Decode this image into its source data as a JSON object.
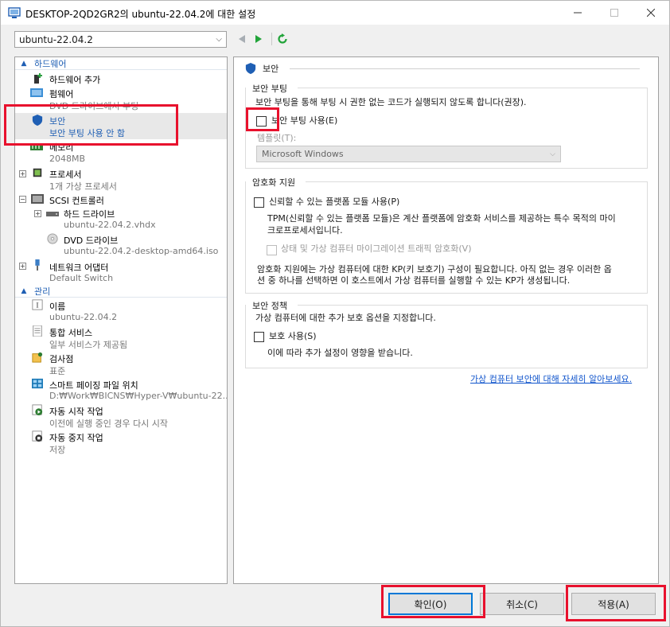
{
  "window": {
    "title": "DESKTOP-2QD2GR2의 ubuntu-22.04.2에 대한 설정"
  },
  "vm_selector": {
    "value": "ubuntu-22.04.2"
  },
  "tree": {
    "hardware_header": "하드웨어",
    "management_header": "관리",
    "hardware_items": [
      {
        "name": "하드웨어 추가",
        "sub": ""
      },
      {
        "name": "펌웨어",
        "sub": "DVD 드라이브에서 부팅"
      },
      {
        "name": "보안",
        "sub": "보안 부팅 사용 안 함"
      },
      {
        "name": "메모리",
        "sub": "2048MB"
      },
      {
        "name": "프로세서",
        "sub": "1개 가상 프로세서"
      },
      {
        "name": "SCSI 컨트롤러",
        "sub": ""
      },
      {
        "name": "하드 드라이브",
        "sub": "ubuntu-22.04.2.vhdx"
      },
      {
        "name": "DVD 드라이브",
        "sub": "ubuntu-22.04.2-desktop-amd64.iso"
      },
      {
        "name": "네트워크 어댑터",
        "sub": "Default Switch"
      }
    ],
    "management_items": [
      {
        "name": "이름",
        "sub": "ubuntu-22.04.2"
      },
      {
        "name": "통합 서비스",
        "sub": "일부 서비스가 제공됨"
      },
      {
        "name": "검사점",
        "sub": "표준"
      },
      {
        "name": "스마트 페이징 파일 위치",
        "sub": "D:₩Work₩BICNS₩Hyper-V₩ubuntu-22...."
      },
      {
        "name": "자동 시작 작업",
        "sub": "이전에 실행 중인 경우 다시 시작"
      },
      {
        "name": "자동 중지 작업",
        "sub": "저장"
      }
    ]
  },
  "content": {
    "header": "보안",
    "secure_boot": {
      "group": "보안 부팅",
      "description": "보안 부팅을 통해 부팅 시 권한 없는 코드가 실행되지 않도록 합니다(권장).",
      "checkbox_label": "보안 부팅 사용(E)",
      "checked": false,
      "template_label": "템플릿(T):",
      "template_value": "Microsoft Windows"
    },
    "encryption": {
      "group": "암호화 지원",
      "tpm_label": "신뢰할 수 있는 플랫폼 모듈 사용(P)",
      "tpm_checked": false,
      "tpm_desc_line1": "TPM(신뢰할 수 있는 플랫폼 모듈)은 계산 플랫폼에 암호화 서비스를 제공하는 특수 목적의 마이",
      "tpm_desc_line2": "크로프로세서입니다.",
      "migration_label": "상태 및 가상 컴퓨터 마이그레이션 트래픽 암호화(V)",
      "migration_checked": false,
      "note_line1": "암호화 지원에는 가상 컴퓨터에 대한 KP(키 보호기) 구성이 필요합니다. 아직 없는 경우 이러한 옵",
      "note_line2": "션 중 하나를 선택하면 이 호스트에서 가상 컴퓨터를 실행할 수 있는 KP가 생성됩니다."
    },
    "policy": {
      "group": "보안 정책",
      "description": "가상 컴퓨터에 대한 추가 보호 옵션을 지정합니다.",
      "checkbox_label": "보호 사용(S)",
      "checked": false,
      "note": "이에 따라 추가 설정이 영향을 받습니다."
    },
    "learn_more_link": "가상 컴퓨터 보안에 대해 자세히 알아보세요."
  },
  "buttons": {
    "ok": "확인(O)",
    "cancel": "취소(C)",
    "apply": "적용(A)"
  },
  "colors": {
    "accent": "#1f5fb4",
    "highlight": "#e8112d",
    "play_green": "#22a43a"
  }
}
